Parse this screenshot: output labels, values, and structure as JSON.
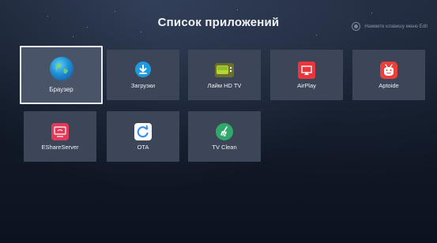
{
  "header": {
    "title": "Список приложений",
    "hint": "Нажмите клавишу меню Edit"
  },
  "apps": [
    {
      "label": "Браузер",
      "icon": "globe-icon"
    },
    {
      "label": "Загрузки",
      "icon": "download-icon"
    },
    {
      "label": "Лайм HD TV",
      "icon": "lime-tv-icon"
    },
    {
      "label": "AirPlay",
      "icon": "airplay-icon"
    },
    {
      "label": "Aptoide",
      "icon": "aptoide-icon"
    },
    {
      "label": "EShareServer",
      "icon": "eshare-icon"
    },
    {
      "label": "OTA",
      "icon": "ota-update-icon"
    },
    {
      "label": "TV Clean",
      "icon": "broom-icon"
    }
  ],
  "colors": {
    "tile": "#3c4658",
    "focus_border": "#e9edf3",
    "download": "#1e9be0",
    "airplay": "#e8363c",
    "aptoide": "#e8403a",
    "eshare": "#e23b5a",
    "ota": "#3b8fe8",
    "tvclean": "#2fa86a"
  }
}
